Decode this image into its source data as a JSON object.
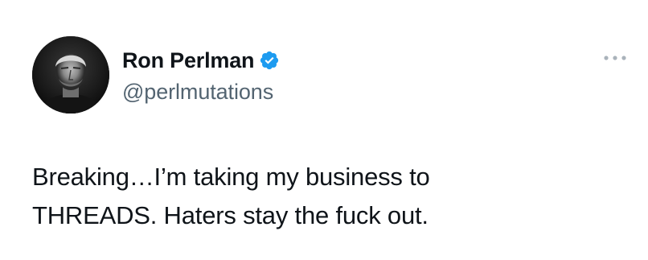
{
  "tweet": {
    "author": {
      "display_name": "Ron Perlman",
      "handle": "@perlmutations",
      "verified": true
    },
    "text": "Breaking…I’m taking my business to\nTHREADS. Haters stay the fuck out.",
    "icons": {
      "verified": "verified-badge-icon",
      "more": "more-options-icon"
    },
    "colors": {
      "verified_blue": "#1d9bf0",
      "handle_gray": "#536471",
      "text": "#0f1419"
    }
  }
}
